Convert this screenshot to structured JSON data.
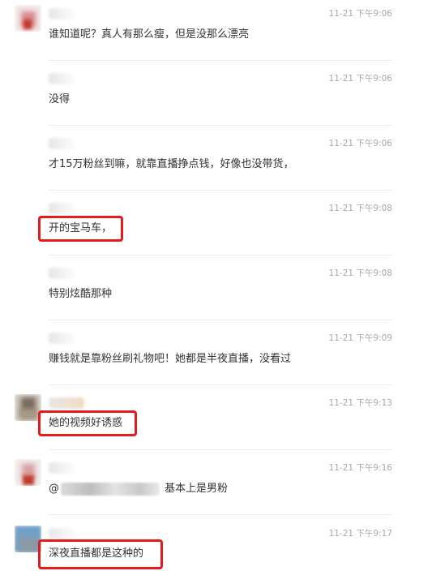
{
  "comments": [
    {
      "time": "11-21 下午9:06",
      "text": "谁知道呢？真人有那么瘦，但是没那么漂亮"
    },
    {
      "time": "11-21 下午9:06",
      "text": "没得"
    },
    {
      "time": "11-21 下午9:06",
      "text": "才15万粉丝到嘛，就靠直播挣点钱，好像也没带货，"
    },
    {
      "time": "11-21 下午9:08",
      "text": "开的宝马车，"
    },
    {
      "time": "11-21 下午9:08",
      "text": "特别炫酷那种"
    },
    {
      "time": "11-21 下午9:09",
      "text": "赚钱就是靠粉丝刷礼物吧！她都是半夜直播，没看过"
    },
    {
      "time": "11-21 下午9:13",
      "text": "她的视频好诱惑"
    },
    {
      "time": "11-21 下午9:16",
      "mention": "@",
      "text": "基本上是男粉"
    },
    {
      "time": "11-21 下午9:17",
      "text": "深夜直播都是这种的"
    }
  ],
  "colors": {
    "highlight": "#e51a1a",
    "time": "#a8a8a8",
    "text": "#333333"
  }
}
